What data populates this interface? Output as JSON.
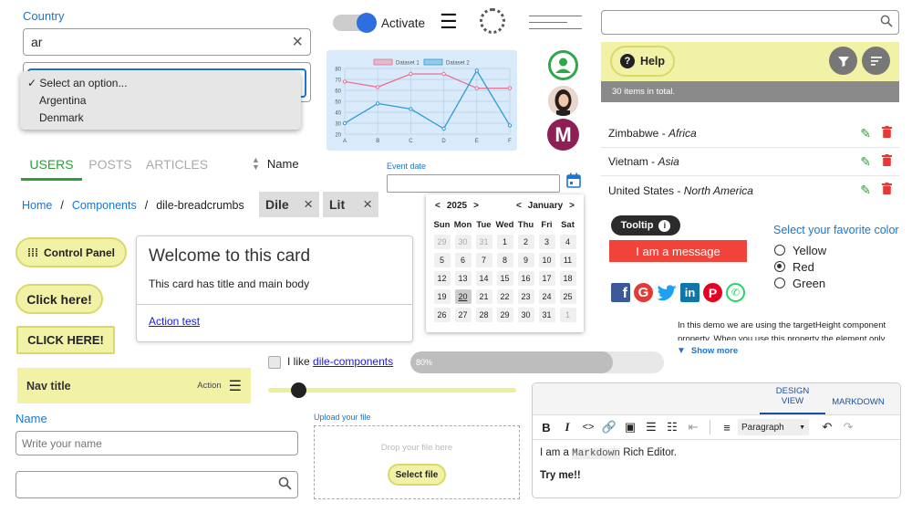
{
  "country": {
    "label": "Country",
    "value": "ar",
    "placeholder": "Select an option...",
    "options": [
      "Select an option...",
      "Argentina",
      "Denmark"
    ]
  },
  "toggle": {
    "label": "Activate"
  },
  "chart_data": {
    "type": "line",
    "categories": [
      "A",
      "B",
      "C",
      "D",
      "E",
      "F"
    ],
    "series": [
      {
        "name": "Dataset 1",
        "values": [
          68,
          63,
          75,
          75,
          62,
          62
        ]
      },
      {
        "name": "Dataset 2",
        "values": [
          30,
          48,
          43,
          25,
          78,
          28
        ]
      }
    ],
    "ylim": [
      20,
      80
    ],
    "yticks": [
      20,
      30,
      40,
      50,
      60,
      70,
      80
    ],
    "colors": [
      "#e8728e",
      "#2d9bd6"
    ],
    "legend": "top-center",
    "grid": true
  },
  "avatars": {
    "letter": "M"
  },
  "tabs": [
    "USERS",
    "POSTS",
    "ARTICLES"
  ],
  "sort": {
    "label": "Name"
  },
  "event_date": {
    "label": "Event date",
    "value": ""
  },
  "breadcrumb": {
    "home": "Home",
    "sep1": "/",
    "components": "Components",
    "sep2": "/",
    "current": "dile-breadcrumbs"
  },
  "chips": [
    "Dile",
    "Lit"
  ],
  "calendar": {
    "year": "2025",
    "month": "January",
    "weekdays": [
      "Sun",
      "Mon",
      "Tue",
      "Wed",
      "Thu",
      "Fri",
      "Sat"
    ],
    "weeks": [
      [
        "29",
        "30",
        "31",
        "1",
        "2",
        "3",
        "4"
      ],
      [
        "5",
        "6",
        "7",
        "8",
        "9",
        "10",
        "11"
      ],
      [
        "12",
        "13",
        "14",
        "15",
        "16",
        "17",
        "18"
      ],
      [
        "19",
        "20",
        "21",
        "22",
        "23",
        "24",
        "25"
      ],
      [
        "26",
        "27",
        "28",
        "29",
        "30",
        "31",
        "1"
      ]
    ]
  },
  "buttons": {
    "control_panel": "Control Panel",
    "click_here": "Click here!",
    "click_here_caps": "CLICK HERE!"
  },
  "card": {
    "title": "Welcome to this card",
    "body": "This card has title and main body",
    "action": "Action test"
  },
  "nav": {
    "title": "Nav title",
    "action": "Action"
  },
  "checkbox": {
    "label": "I like",
    "link": "dile-components"
  },
  "progress": {
    "label": "80%",
    "value": 0.8
  },
  "slider": {
    "value": 0.08
  },
  "name_field": {
    "label": "Name",
    "placeholder": "Write your name"
  },
  "upload": {
    "label": "Upload your file",
    "drop": "Drop your file here",
    "button": "Select file"
  },
  "editor": {
    "tabs": [
      "DESIGN VIEW",
      "MARKDOWN"
    ],
    "format": "Paragraph",
    "line1_pre": "I am a",
    "line1_code": "Markdown",
    "line1_post": "Rich Editor.",
    "line2": "Try me!!"
  },
  "right_search": {
    "placeholder": ""
  },
  "help": {
    "label": "Help"
  },
  "count_bar": {
    "text": "30 items in total."
  },
  "countries": [
    {
      "name": "Zimbabwe",
      "sep": " - ",
      "continent": "Africa"
    },
    {
      "name": "Vietnam",
      "sep": " - ",
      "continent": "Asia"
    },
    {
      "name": "United States",
      "sep": " - ",
      "continent": "North America"
    }
  ],
  "tooltip": {
    "label": "Tooltip"
  },
  "message": {
    "text": "I am a message"
  },
  "color_select": {
    "title": "Select your favorite color",
    "options": [
      "Yellow",
      "Red",
      "Green"
    ],
    "selected": "Red"
  },
  "demo": {
    "line1": "In this demo we are using the targetHeight component",
    "line2": "property. When you use this property the element only",
    "show_more": "Show more"
  },
  "colors": {
    "accent": "#1976d2",
    "yellow": "#f2f2a6",
    "green": "#2e9d3a",
    "red": "#e53935",
    "purple": "#8e1f54"
  }
}
